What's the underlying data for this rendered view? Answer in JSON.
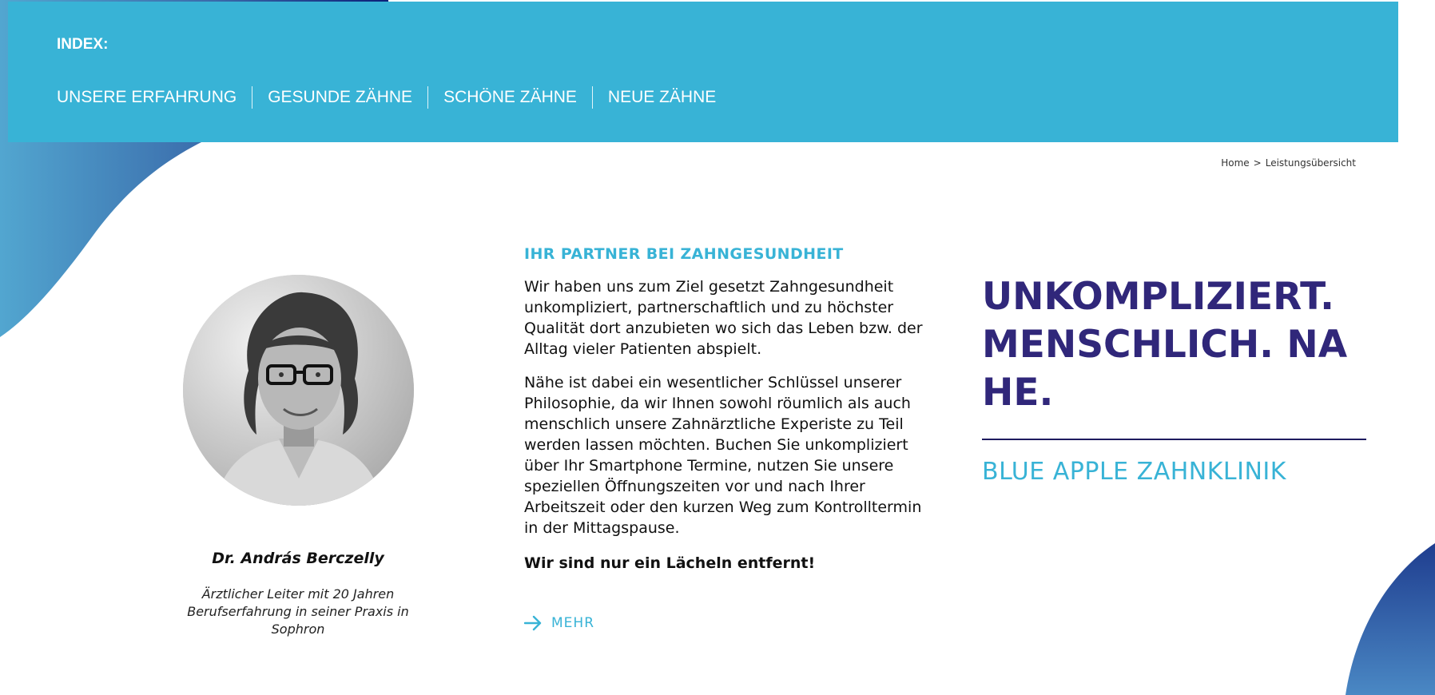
{
  "header": {
    "index_label": "INDEX:",
    "nav": [
      {
        "label": "UNSERE ERFAHRUNG"
      },
      {
        "label": "GESUNDE ZÄHNE"
      },
      {
        "label": "SCHÖNE ZÄHNE"
      },
      {
        "label": "NEUE ZÄHNE"
      }
    ]
  },
  "breadcrumb": {
    "home": "Home",
    "separator": ">",
    "current": "Leistungsübersicht"
  },
  "doctor": {
    "name": "Dr. András Berczelly",
    "role": "Ärztlicher Leiter mit 20 Jahren Berufserfahrung in seiner Praxis in Sophron"
  },
  "main": {
    "heading": "IHR PARTNER BEI ZAHNGESUNDHEIT",
    "paragraph_1": "Wir haben uns zum Ziel gesetzt Zahngesundheit unkompliziert, partnerschaftlich und zu höchster Qualität dort anzubieten wo sich das Leben bzw. der Alltag vieler Patienten abspielt.",
    "paragraph_2": "Nähe ist dabei ein wesentlicher Schlüssel unserer Philosophie, da wir Ihnen sowohl röumlich als auch menschlich unsere Zahnärztliche Experiste zu Teil werden lassen möchten. Buchen Sie unkompliziert über Ihr Smartphone Termine, nutzen Sie unsere speziellen Öffnungszeiten vor und nach Ihrer Arbeitszeit oder den kurzen Weg zum Kontrolltermin in der Mittagspause.",
    "tagline": "Wir sind nur ein Lächeln entfernt!",
    "more_label": "MEHR"
  },
  "hero": {
    "headline_lines": [
      "UNKOMPLIZIERT.",
      "MENSCHLICH. NA",
      "HE."
    ],
    "clinic_name": "BLUE APPLE ZAHNKLINIK"
  },
  "colors": {
    "accent": "#38b3d6",
    "headline": "#30277a",
    "blob_dark": "#0b1f78",
    "blob_light": "#4fa3cf"
  }
}
